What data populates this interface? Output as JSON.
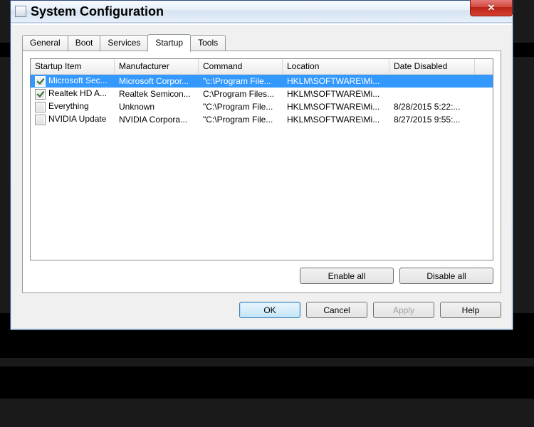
{
  "window": {
    "title": "System Configuration"
  },
  "tabs": {
    "general": "General",
    "boot": "Boot",
    "services": "Services",
    "startup": "Startup",
    "tools": "Tools"
  },
  "headers": {
    "item": "Startup Item",
    "manufacturer": "Manufacturer",
    "command": "Command",
    "location": "Location",
    "date": "Date Disabled"
  },
  "rows": [
    {
      "checked": true,
      "item": "Microsoft Sec...",
      "manufacturer": "Microsoft Corpor...",
      "command": "\"c:\\Program File...",
      "location": "HKLM\\SOFTWARE\\Mi...",
      "date": ""
    },
    {
      "checked": true,
      "item": "Realtek HD A...",
      "manufacturer": "Realtek Semicon...",
      "command": "C:\\Program Files...",
      "location": "HKLM\\SOFTWARE\\Mi...",
      "date": ""
    },
    {
      "checked": false,
      "item": "Everything",
      "manufacturer": "Unknown",
      "command": "\"C:\\Program File...",
      "location": "HKLM\\SOFTWARE\\Mi...",
      "date": "8/28/2015 5:22:..."
    },
    {
      "checked": false,
      "item": "NVIDIA Update",
      "manufacturer": "NVIDIA Corpora...",
      "command": "\"C:\\Program File...",
      "location": "HKLM\\SOFTWARE\\Mi...",
      "date": "8/27/2015 9:55:..."
    }
  ],
  "buttons": {
    "enable_all": "Enable all",
    "disable_all": "Disable all",
    "ok": "OK",
    "cancel": "Cancel",
    "apply": "Apply",
    "help": "Help"
  }
}
